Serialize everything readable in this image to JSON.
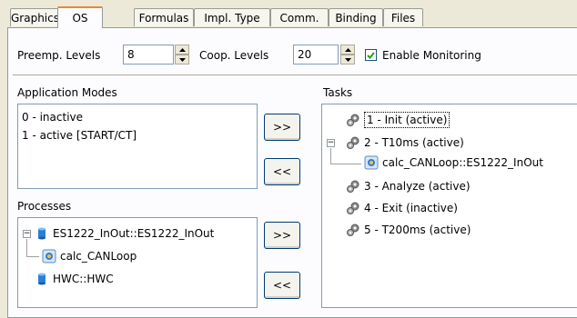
{
  "tabs": [
    "Graphics",
    "OS",
    "Formulas",
    "Impl. Type",
    "Comm.",
    "Binding",
    "Files"
  ],
  "active_tab": "OS",
  "preemp": {
    "label": "Preemp. Levels",
    "value": "8"
  },
  "coop": {
    "label": "Coop. Levels",
    "value": "20"
  },
  "monitoring": {
    "label": "Enable Monitoring",
    "checked": true
  },
  "app_modes": {
    "label": "Application Modes",
    "items": [
      "0 - inactive",
      "1 - active [START/CT]"
    ]
  },
  "processes": {
    "label": "Processes",
    "items": [
      "ES1222_InOut::ES1222_InOut",
      "calc_CANLoop",
      "HWC::HWC"
    ]
  },
  "tasks": {
    "label": "Tasks",
    "items": [
      "1 - Init (active)",
      "2 - T10ms (active)",
      "calc_CANLoop::ES1222_InOut",
      "3 - Analyze (active)",
      "4 - Exit (inactive)",
      "5 - T200ms (active)"
    ]
  },
  "buttons": {
    "add": ">>",
    "remove": "<<"
  },
  "tree_signs": {
    "minus": "−"
  },
  "colors": {
    "accent": "#e68b2c",
    "border": "#7f9db9",
    "face": "#ece9d8"
  }
}
